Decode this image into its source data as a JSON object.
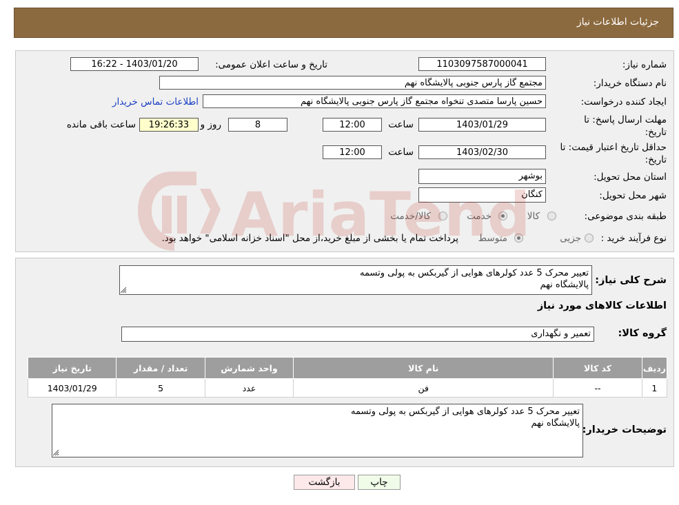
{
  "header": {
    "title": "جزئیات اطلاعات نیاز"
  },
  "labels": {
    "need_number": "شماره نیاز:",
    "announce_datetime": "تاریخ و ساعت اعلان عمومی:",
    "buyer_org": "نام دستگاه خریدار:",
    "requester": "ایجاد کننده درخواست:",
    "contact_link": "اطلاعات تماس خریدار",
    "reply_deadline_1": "مهلت ارسال پاسخ: تا",
    "reply_deadline_2": "تاریخ:",
    "time": "ساعت",
    "day_and": "روز و",
    "remaining": "ساعت باقی مانده",
    "validity_1": "حداقل تاریخ اعتبار قیمت: تا",
    "validity_2": "تاریخ:",
    "province": "استان محل تحویل:",
    "city": "شهر محل تحویل:",
    "category": "طبقه بندی موضوعی:",
    "purchase_type": "نوع فرآیند خرید :",
    "general_desc": "شرح کلی نیاز:",
    "goods_info": "اطلاعات کالاهای مورد نیاز",
    "goods_group": "گروه کالا:",
    "buyer_notes": "توضیحات خریدار:"
  },
  "values": {
    "need_number": "1103097587000041",
    "announce_datetime": "1403/01/20 - 16:22",
    "buyer_org": "مجتمع گاز پارس جنوبی  پالایشگاه نهم",
    "requester": "حسین پارسا متصدی تنخواه مجتمع گاز پارس جنوبی  پالایشگاه نهم",
    "reply_date": "1403/01/29",
    "reply_time": "12:00",
    "days": "8",
    "remaining_time": "19:26:33",
    "validity_date": "1403/02/30",
    "validity_time": "12:00",
    "province": "بوشهر",
    "city": "کنگان",
    "general_desc_line1": "تعییر محرک 5 عدد کولرهای هوایی از گیربکس به پولی وتسمه",
    "general_desc_line2": "پالایشگاه نهم",
    "goods_group": "تعمیر و نگهداری",
    "buyer_notes_line1": "تعییر محرک 5 عدد کولرهای هوایی از گیربکس به پولی وتسمه",
    "buyer_notes_line2": "پالایشگاه نهم"
  },
  "category_options": {
    "goods": "کالا",
    "service": "خدمت",
    "goods_service": "کالا/خدمت",
    "selected": "خدمت"
  },
  "purchase_options": {
    "small": "جزیی",
    "medium": "متوسط",
    "note": "پرداخت تمام یا بخشی از مبلغ خرید،از محل \"اسناد خزانه اسلامی\" خواهد بود.",
    "selected": "متوسط"
  },
  "table": {
    "headers": [
      "ردیف",
      "کد کالا",
      "نام کالا",
      "واحد شمارش",
      "تعداد / مقدار",
      "تاریخ نیاز"
    ],
    "rows": [
      {
        "row": "1",
        "code": "--",
        "name": "فن",
        "unit": "عدد",
        "qty": "5",
        "date": "1403/01/29"
      }
    ]
  },
  "buttons": {
    "print": "چاپ",
    "back": "بازگشت"
  },
  "watermark": "AriaTender.neT",
  "colors": {
    "header_bg": "#8c6a3f",
    "table_header_bg": "#9e9e9e",
    "print_bg": "#f0fbe8",
    "back_bg": "#fde8ea",
    "link": "#1a3fc4",
    "watermark": "#c0392b"
  }
}
